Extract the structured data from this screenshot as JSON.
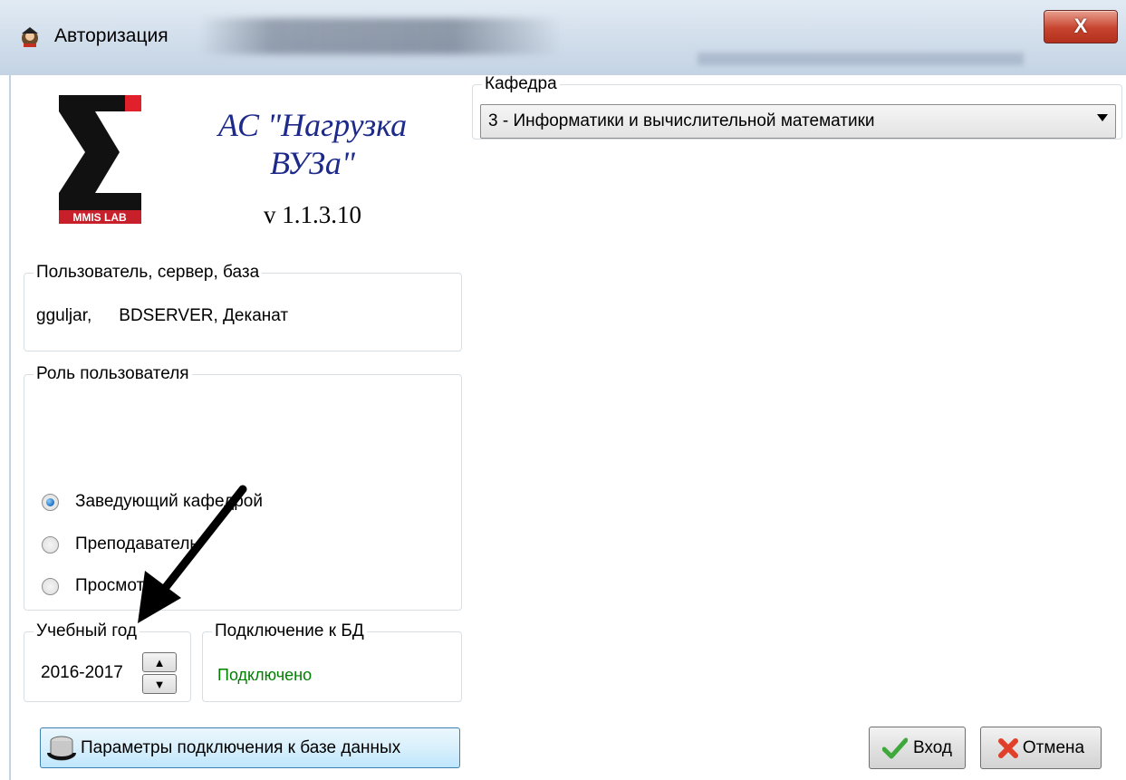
{
  "window": {
    "title": "Авторизация",
    "close_label": "X"
  },
  "app": {
    "name_line1": "АС \"Нагрузка",
    "name_line2": "ВУЗа\"",
    "version": "v 1.1.3.10",
    "logo_text": "MMIS LAB"
  },
  "user_group": {
    "legend": "Пользователь, сервер, база",
    "user": "gguljar,",
    "server": "BDSERVER,",
    "database": "Деканат"
  },
  "role_group": {
    "legend": "Роль пользователя",
    "options": [
      {
        "label": "Заведующий кафедрой",
        "selected": true
      },
      {
        "label": "Преподаватель",
        "selected": false
      },
      {
        "label": "Просмотр",
        "selected": false
      }
    ]
  },
  "year_group": {
    "legend": "Учебный год",
    "value": "2016-2017"
  },
  "db_group": {
    "legend": "Подключение к БД",
    "status": "Подключено",
    "status_color": "#008000"
  },
  "kafedra_group": {
    "legend": "Кафедра",
    "selected": "3 - Информатики и вычислительной математики"
  },
  "buttons": {
    "params": "Параметры подключения к базе данных",
    "enter": "Вход",
    "cancel": "Отмена"
  },
  "colors": {
    "app_name": "#1e2a8a",
    "logo_red": "#e0202a",
    "close_red": "#c7442f"
  }
}
